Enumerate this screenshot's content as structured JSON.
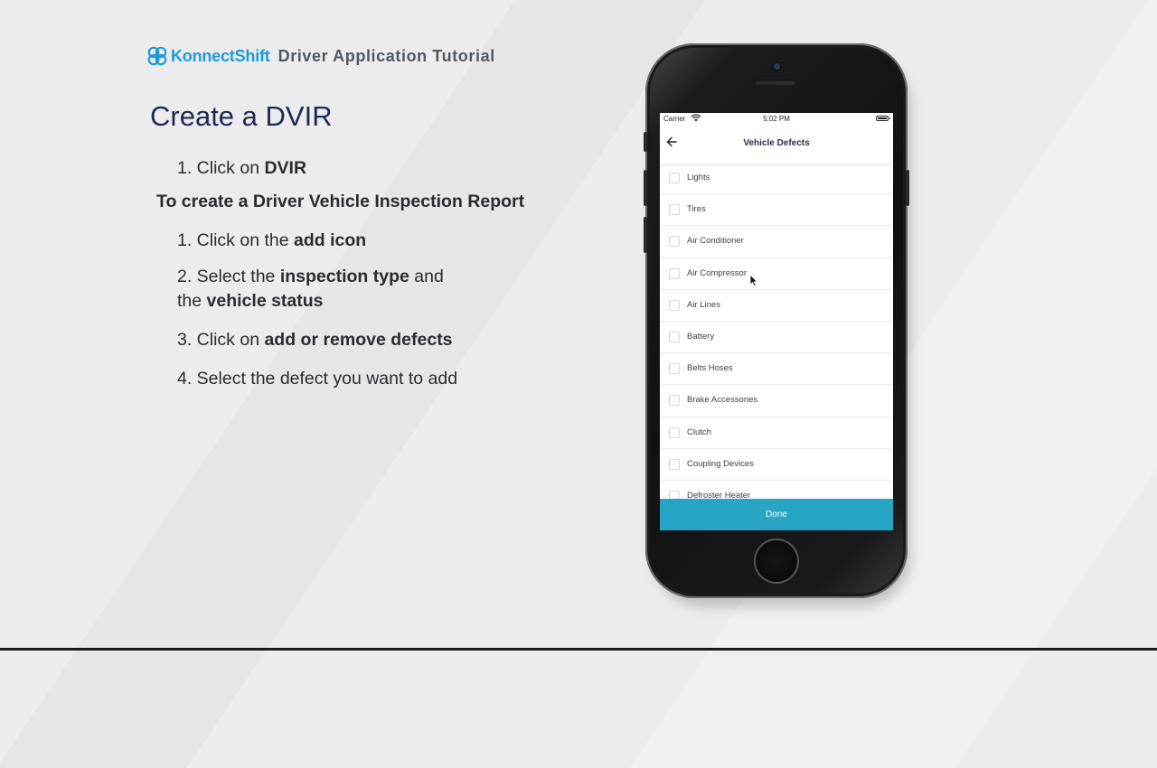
{
  "header": {
    "brand_name": "KonnectShift",
    "brand_subtitle": "Driver Application Tutorial",
    "brand_color": "#1f9ad6"
  },
  "instructions": {
    "title": "Create a DVIR",
    "step_dvir": {
      "prefix": "1. Click on ",
      "bold": "DVIR"
    },
    "subheading": "To create a Driver Vehicle Inspection Report",
    "steps": [
      {
        "prefix": "1. Click on the ",
        "bold": "add icon",
        "suffix": ""
      },
      {
        "prefix": "2. Select the ",
        "bold": "inspection type",
        "suffix": " and",
        "line2_prefix": "the ",
        "line2_bold": "vehicle status"
      },
      {
        "prefix": "3. Click on ",
        "bold": "add or remove defects",
        "suffix": ""
      },
      {
        "prefix": "4. Select the defect you want to add"
      }
    ]
  },
  "phone": {
    "statusbar": {
      "carrier": "Carrier",
      "time": "5:02 PM"
    },
    "navbar": {
      "title": "Vehicle Defects",
      "back_icon": "arrow-left-icon"
    },
    "defects": [
      {
        "label": "Lights",
        "checked": false
      },
      {
        "label": "Tires",
        "checked": false
      },
      {
        "label": "Air Conditioner",
        "checked": false
      },
      {
        "label": "Air Compressor",
        "checked": false
      },
      {
        "label": "Air Lines",
        "checked": false
      },
      {
        "label": "Battery",
        "checked": false
      },
      {
        "label": "Belts Hoses",
        "checked": false
      },
      {
        "label": "Brake Accessories",
        "checked": false
      },
      {
        "label": "Clutch",
        "checked": false
      },
      {
        "label": "Coupling Devices",
        "checked": false
      },
      {
        "label": "Defroster Heater",
        "checked": false
      }
    ],
    "done_label": "Done",
    "accent_color": "#26a6c4"
  }
}
